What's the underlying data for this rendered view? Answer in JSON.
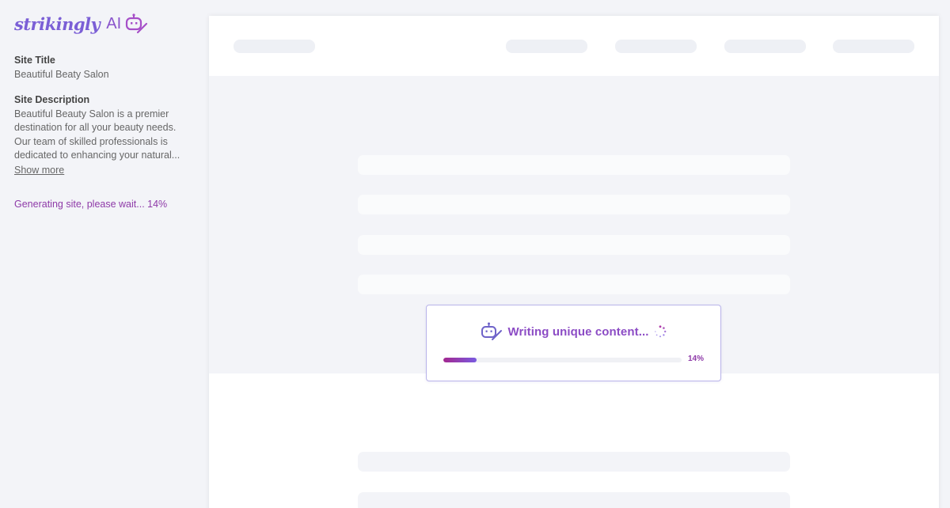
{
  "brand": {
    "name": "strikingly",
    "suffix": "AI",
    "icon": "robot-pencil-icon",
    "color": "#7b5fd6"
  },
  "site": {
    "title_label": "Site Title",
    "title_value": "Beautiful Beaty Salon",
    "description_label": "Site Description",
    "description_lines": [
      "Beautiful Beauty Salon is a premier",
      "destination for all your beauty needs.",
      "Our team of skilled professionals is",
      "dedicated to enhancing your natural..."
    ],
    "show_more": "Show more"
  },
  "status": {
    "text": "Generating site, please wait... 14%",
    "color": "#8e3aa8"
  },
  "progress_card": {
    "title": "Writing unique content...",
    "percent_label": "14%",
    "progress": 0.14,
    "icon": "robot-pencil-icon",
    "spinner": "loading-spinner-icon",
    "gradient": [
      "#a3278f",
      "#7a5be0"
    ]
  }
}
